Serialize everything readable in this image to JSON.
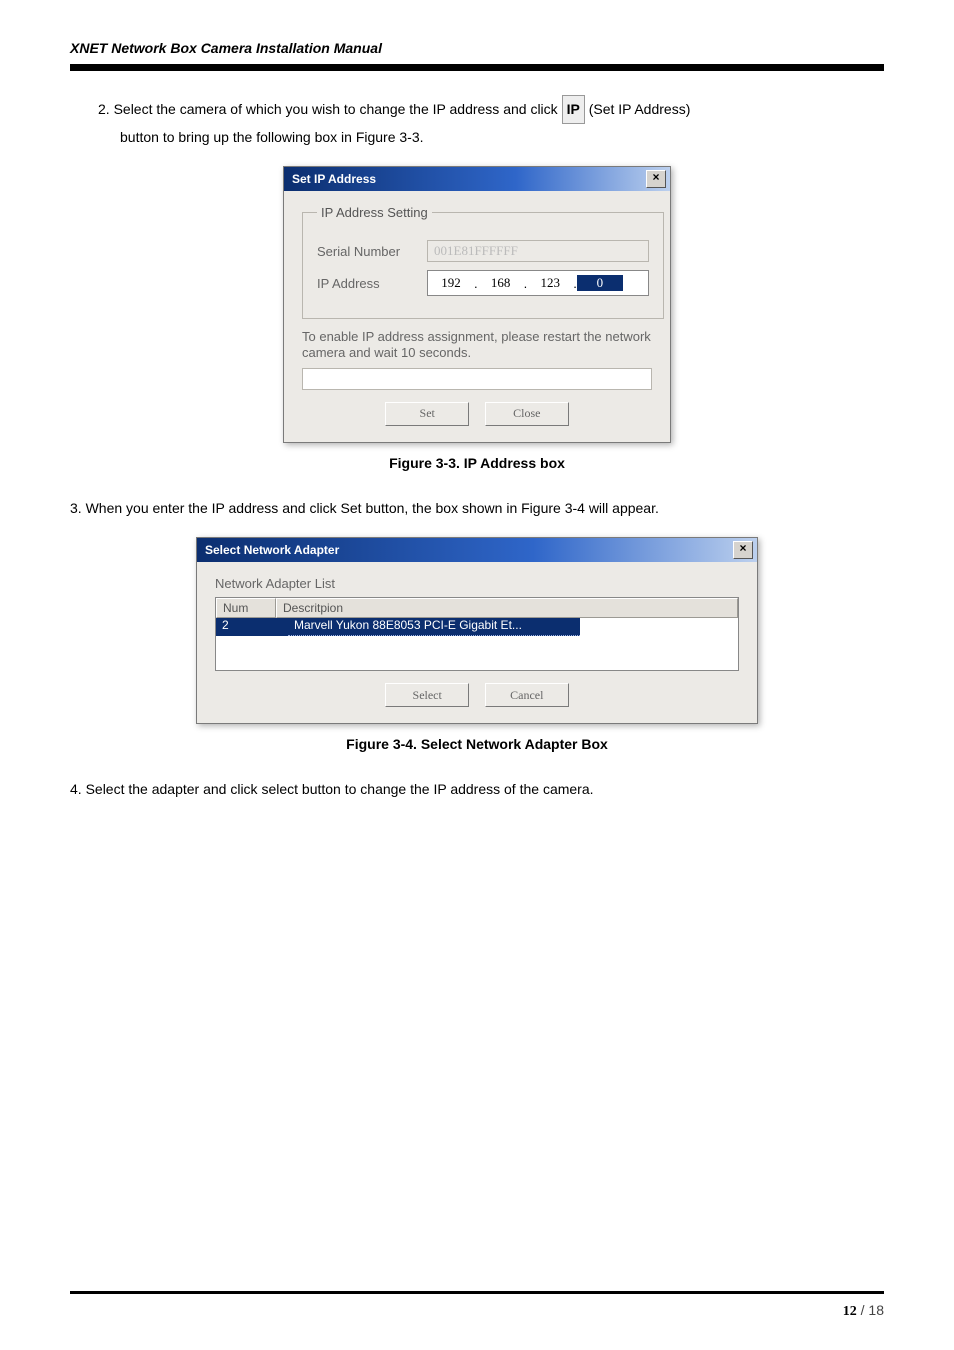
{
  "doc": {
    "header_title": "XNET Network Box Camera Installation Manual",
    "step2a": "2. Select the camera of which you wish to change the IP address and click ",
    "ip_btn": "IP",
    "step2b": "(Set IP Address)",
    "step2c": "button to bring up the following box in Figure 3-3.",
    "fig33": "Figure 3-3. IP Address box",
    "step3": "3. When you enter the IP address and click Set button, the box shown in Figure 3-4 will appear.",
    "fig34": "Figure 3-4. Select Network Adapter Box",
    "step4": "4. Select the adapter and click select button to change the IP address of the camera.",
    "page_cur": "12",
    "page_sep": " / ",
    "page_total": "18"
  },
  "dlg1": {
    "title": "Set IP Address",
    "close": "×",
    "legend": "IP Address Setting",
    "serial_lbl": "Serial Number",
    "serial_val": "001E81FFFFFF",
    "ip_lbl": "IP Address",
    "ip_oct1": "192",
    "ip_oct2": "168",
    "ip_oct3": "123",
    "ip_oct4": "0",
    "info": "To enable IP address assignment, please restart the network camera and wait  10 seconds.",
    "set_btn": "Set",
    "close_btn": "Close"
  },
  "dlg2": {
    "title": "Select Network Adapter",
    "close": "×",
    "list_label": "Network Adapter List",
    "col_num": "Num",
    "col_desc": "Descritpion",
    "row_num": "2",
    "row_desc": "Marvell Yukon 88E8053 PCI-E Gigabit Et...",
    "select_btn": "Select",
    "cancel_btn": "Cancel"
  }
}
